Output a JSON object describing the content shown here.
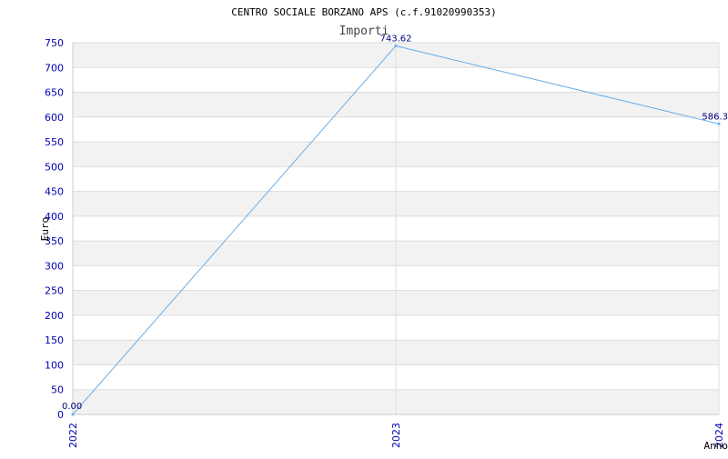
{
  "chart_data": {
    "type": "line",
    "title": "CENTRO SOCIALE BORZANO APS (c.f.91020990353)",
    "subtitle": "Importi",
    "xlabel": "Anno",
    "ylabel": "Euro",
    "categories": [
      "2022",
      "2023",
      "2024"
    ],
    "series": [
      {
        "values": [
          0,
          743.62,
          586.3
        ],
        "labels": [
          "0.00",
          "743.62",
          "586.3"
        ]
      }
    ],
    "ylim": [
      0,
      750
    ],
    "yticks": [
      "0",
      "50",
      "100",
      "150",
      "200",
      "250",
      "300",
      "350",
      "400",
      "450",
      "500",
      "550",
      "600",
      "650",
      "700",
      "750"
    ],
    "grid": true,
    "colors": {
      "line": "#6aaee8",
      "band": "#f2f2f2",
      "tick": "#0000b0",
      "label": "#000080"
    }
  }
}
